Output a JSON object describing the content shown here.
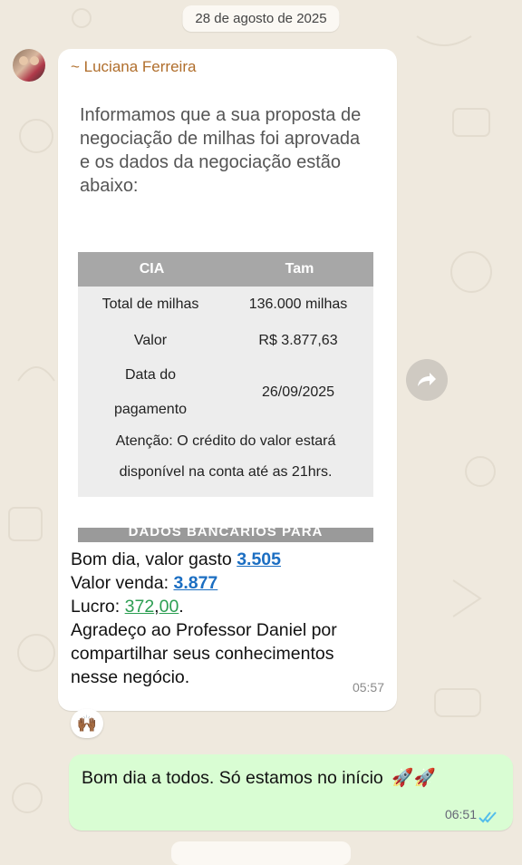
{
  "chat": {
    "date_top": "28 de agosto de 2025",
    "date_bottom": ""
  },
  "message_in": {
    "sender": "~ Luciana Ferreira",
    "image": {
      "intro": "Informamos que a sua proposta de negociação de milhas foi aprovada e os dados da negociação estão abaixo:",
      "table": {
        "head": [
          "CIA",
          "Tam"
        ],
        "rows": [
          {
            "label": "Total de milhas",
            "value": "136.000 milhas"
          },
          {
            "label": "Valor",
            "value": "R$ 3.877,63"
          },
          {
            "label_line1": "Data do",
            "label_line2": "pagamento",
            "value": "26/09/2025"
          }
        ],
        "note_line1": "Atenção: O crédito do valor estará",
        "note_line2": "disponível na conta até as 21hrs."
      },
      "second_table_head": "DADOS BANCÁRIOS PARA"
    },
    "caption": {
      "line1_prefix": "Bom dia, valor gasto ",
      "gasto": "3.505",
      "line2_prefix": "Valor venda: ",
      "venda": "3.877",
      "line3_prefix": "Lucro: ",
      "lucro_int": "372",
      "lucro_sep": ",",
      "lucro_dec": "00",
      "lucro_end": ".",
      "line4": "Agradeço ao Professor Daniel por compartilhar seus conhecimentos nesse negócio."
    },
    "time": "05:57",
    "reaction": "🙌🏾"
  },
  "message_out": {
    "text": "Bom dia a todos. Só estamos no início",
    "emoji": "🚀🚀",
    "time": "06:51"
  },
  "colors": {
    "wallpaper": "#efe9de",
    "incoming": "#ffffff",
    "outgoing": "#d9fdd3",
    "sender": "#b06e2c",
    "link_blue": "#1b6ec2",
    "link_green": "#2c9e52",
    "read_ticks": "#53bdeb"
  },
  "icons": [
    "forward-icon",
    "double-check-icon",
    "avatar"
  ]
}
